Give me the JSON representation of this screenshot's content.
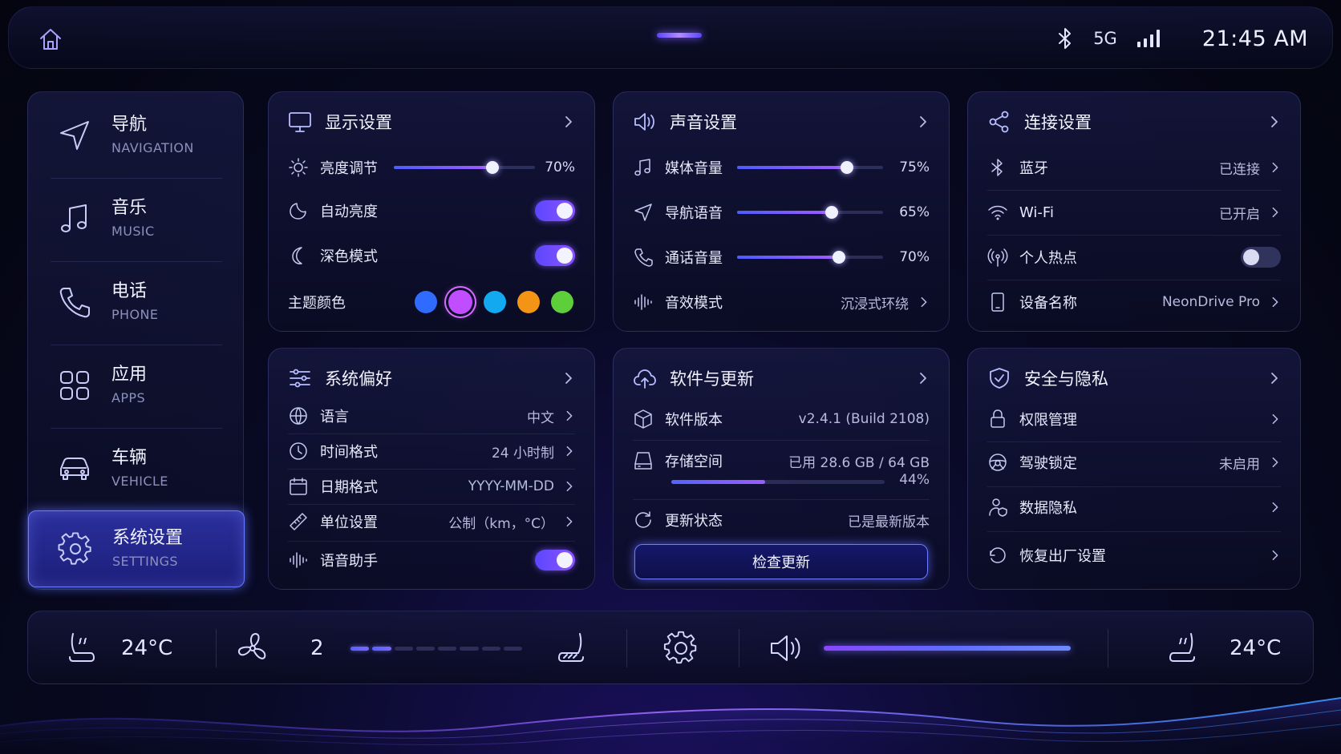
{
  "status": {
    "network": "5G",
    "time": "21:45 AM"
  },
  "sidebar": {
    "items": [
      {
        "zh": "导航",
        "en": "NAVIGATION",
        "icon": "navigation-icon"
      },
      {
        "zh": "音乐",
        "en": "MUSIC",
        "icon": "music-icon"
      },
      {
        "zh": "电话",
        "en": "PHONE",
        "icon": "phone-icon"
      },
      {
        "zh": "应用",
        "en": "APPS",
        "icon": "apps-icon"
      },
      {
        "zh": "车辆",
        "en": "VEHICLE",
        "icon": "car-icon"
      },
      {
        "zh": "系统设置",
        "en": "SETTINGS",
        "icon": "gear-icon",
        "active": true
      }
    ]
  },
  "display": {
    "title": "显示设置",
    "brightness": {
      "label": "亮度调节",
      "value": "70%",
      "level": 0.7
    },
    "auto_brightness": {
      "label": "自动亮度",
      "on": true
    },
    "dark_mode": {
      "label": "深色模式",
      "on": true
    },
    "theme": {
      "label": "主题颜色",
      "colors": [
        "#2f6bff",
        "#c04dff",
        "#12a9f0",
        "#f39414",
        "#5ccf3a"
      ],
      "selected": 1
    }
  },
  "sound": {
    "title": "声音设置",
    "media": {
      "label": "媒体音量",
      "value": "75%",
      "level": 0.75
    },
    "nav_voice": {
      "label": "导航语音",
      "value": "65%",
      "level": 0.65
    },
    "call": {
      "label": "通话音量",
      "value": "70%",
      "level": 0.7
    },
    "effect": {
      "label": "音效模式",
      "value": "沉浸式环绕"
    }
  },
  "connect": {
    "title": "连接设置",
    "bluetooth": {
      "label": "蓝牙",
      "value": "已连接"
    },
    "wifi": {
      "label": "Wi-Fi",
      "value": "已开启"
    },
    "hotspot": {
      "label": "个人热点",
      "on": false
    },
    "device": {
      "label": "设备名称",
      "value": "NeonDrive Pro"
    }
  },
  "prefs": {
    "title": "系统偏好",
    "language": {
      "label": "语言",
      "value": "中文"
    },
    "time_format": {
      "label": "时间格式",
      "value": "24 小时制"
    },
    "date_format": {
      "label": "日期格式",
      "value": "YYYY-MM-DD"
    },
    "units": {
      "label": "单位设置",
      "value": "公制（km，°C）"
    },
    "assistant": {
      "label": "语音助手",
      "on": true
    }
  },
  "software": {
    "title": "软件与更新",
    "version": {
      "label": "软件版本",
      "value": "v2.4.1 (Build 2108)"
    },
    "storage": {
      "label": "存储空间",
      "value": "已用 28.6 GB / 64 GB",
      "percent": "44%",
      "level": 0.44
    },
    "update_status": {
      "label": "更新状态",
      "value": "已是最新版本"
    },
    "check_button": "检查更新"
  },
  "security": {
    "title": "安全与隐私",
    "permissions": {
      "label": "权限管理"
    },
    "drive_lock": {
      "label": "驾驶锁定",
      "value": "未启用"
    },
    "privacy": {
      "label": "数据隐私"
    },
    "reset": {
      "label": "恢复出厂设置"
    }
  },
  "climate": {
    "left_temp": "24°C",
    "fan_speed": "2",
    "fan_level": 2,
    "fan_max": 8,
    "volume_level": 1.0,
    "right_temp": "24°C"
  },
  "colors": {
    "accent": "#6a5cff",
    "accent2": "#a05cff",
    "background": "#05061a"
  }
}
